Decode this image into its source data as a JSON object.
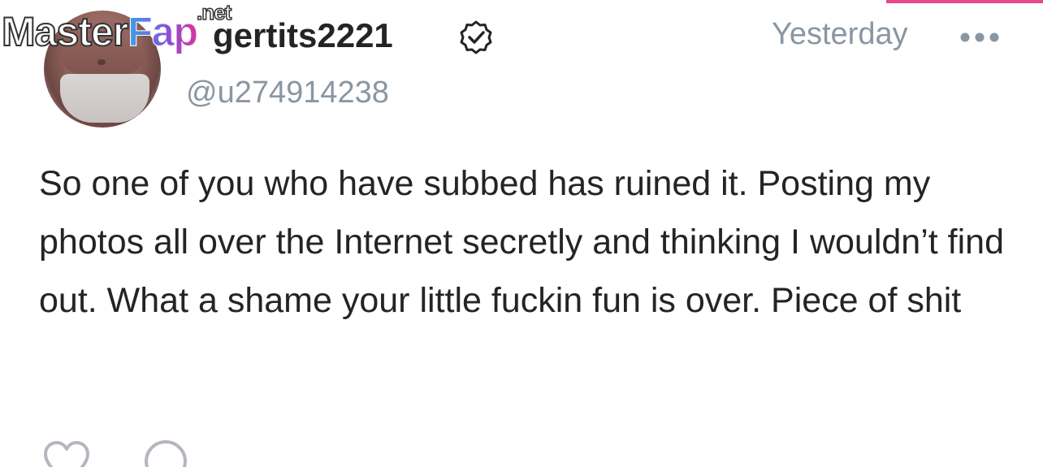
{
  "post": {
    "author": {
      "display_name": "gertits2221",
      "handle": "@u274914238",
      "verified": true,
      "avatar_icon": "avatar-photo"
    },
    "timestamp": "Yesterday",
    "body": "So one of you who have subbed has ruined it. Posting my photos all over the Internet secretly and thinking I wouldn’t find out. What a shame your little fuckin fun is over. Piece of shit",
    "actions": {
      "like_icon": "heart-icon",
      "comment_icon": "comment-icon",
      "more_icon": "more-dots-icon"
    }
  },
  "watermark": {
    "part1": "Master",
    "part2": "Fap",
    "part3": ".net"
  },
  "colors": {
    "accent": "#e8478b",
    "text_primary": "#242424",
    "text_secondary": "#8a96a3",
    "icon_gray": "#b3b8be"
  }
}
